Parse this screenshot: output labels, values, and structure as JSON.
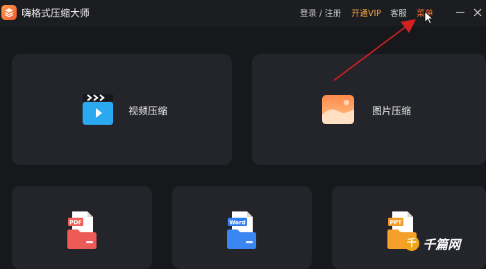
{
  "window": {
    "title": "嗨格式压缩大师",
    "links": {
      "login": "登录 / 注册",
      "vip": "开通VIP",
      "service": "客服",
      "menu": "菜单"
    }
  },
  "cards": {
    "video": {
      "label": "视频压缩",
      "icon": "video-clapper-icon"
    },
    "image": {
      "label": "图片压缩",
      "icon": "image-icon"
    },
    "pdf": {
      "badge": "PDF",
      "icon": "pdf-folder-icon"
    },
    "word": {
      "badge": "Word",
      "icon": "word-folder-icon"
    },
    "ppt": {
      "badge": "PPT",
      "icon": "ppt-folder-icon"
    }
  },
  "watermark": {
    "glyph": "千",
    "text": "千篇网"
  },
  "colors": {
    "background": "#17181b",
    "card": "#24252a",
    "vip": "#f0a44a",
    "menu": "#ff6b2c",
    "annotation_arrow": "#d42020"
  }
}
